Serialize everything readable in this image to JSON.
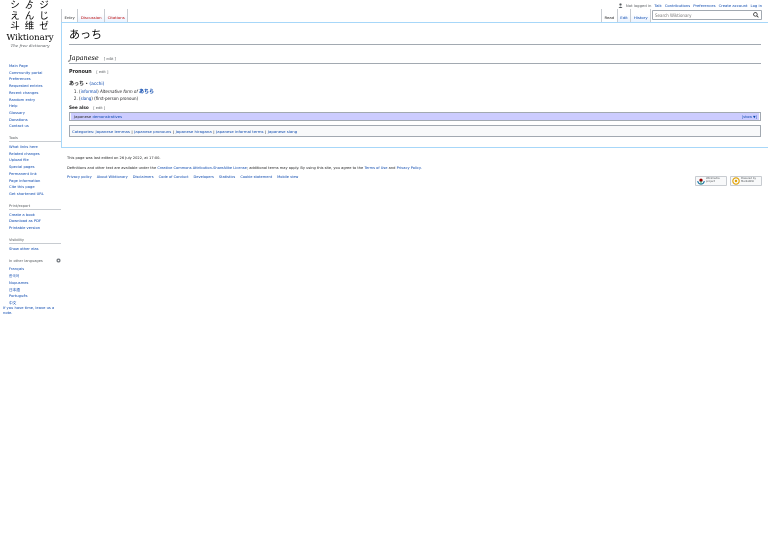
{
  "personal": {
    "not_logged_in": "Not logged in",
    "talk": "Talk",
    "contributions": "Contributions",
    "preferences": "Preferences",
    "create_account": "Create account",
    "log_in": "Log in"
  },
  "logo": {
    "glyph_rows": [
      "シ ゟ ジ",
      "え ん じ",
      "斗 维 ゼ"
    ],
    "wordmark": "Wiktionary",
    "tagline": "The free dictionary"
  },
  "sidebar": {
    "navigation": [
      "Main Page",
      "Community portal",
      "Preferences",
      "Requested entries",
      "Recent changes",
      "Random entry",
      "Help",
      "Glossary",
      "Donations",
      "Contact us"
    ],
    "tools_heading": "Tools",
    "tools": [
      "What links here",
      "Related changes",
      "Upload file",
      "Special pages",
      "Permanent link",
      "Page information",
      "Cite this page",
      "Get shortened URL"
    ],
    "print_heading": "Print/export",
    "print": [
      "Create a book",
      "Download as PDF",
      "Printable version"
    ],
    "visibility_heading": "Visibility",
    "visibility": [
      "Show other elas"
    ],
    "languages_heading": "In other languages",
    "languages": [
      "Français",
      "한국어",
      "Nupusmes",
      "日本語",
      "Português",
      "中文"
    ],
    "login_note": "If you have time, leave us a note."
  },
  "tabs": {
    "left": [
      "Entry",
      "Discussion",
      "Citations"
    ],
    "right": [
      "Read",
      "Edit",
      "History"
    ]
  },
  "search": {
    "placeholder": "Search Wiktionary"
  },
  "content": {
    "title": "あっち",
    "language_heading": "Japanese",
    "edit_label": "[ edit ]",
    "pos_heading": "Pronoun",
    "headword": "あっち",
    "romanization": "(acchi)",
    "definitions": [
      {
        "tag": "informal",
        "text": "Alternative form of",
        "link": "あちら"
      },
      {
        "tag": "slang",
        "text": "first-person pronoun"
      }
    ],
    "see_also_heading": "See also",
    "navbox_prefix": "Japanese",
    "navbox_link": "demonstratives",
    "navbox_show": "[show ▼]",
    "categories_label": "Categories:",
    "categories": [
      "Japanese lemmas",
      "Japanese pronouns",
      "Japanese hiragana",
      "Japanese informal terms",
      "Japanese slang"
    ]
  },
  "footer": {
    "last_edited": "This page was last edited on 26 July 2022, at 17:00.",
    "license_pre": "Definitions and other text are available under the",
    "license_link": "Creative Commons Attribution-ShareAlike License",
    "license_post": "; additional terms may apply. By using this site, you agree to the",
    "terms_link": "Terms of Use",
    "and": "and",
    "privacy_link": "Privacy Policy.",
    "places": [
      "Privacy policy",
      "About Wiktionary",
      "Disclaimers",
      "Code of Conduct",
      "Developers",
      "Statistics",
      "Cookie statement",
      "Mobile view"
    ],
    "badge_wikimedia": [
      "Wikimedia",
      "project"
    ],
    "badge_mediawiki": [
      "Powered by",
      "MediaWiki"
    ]
  }
}
